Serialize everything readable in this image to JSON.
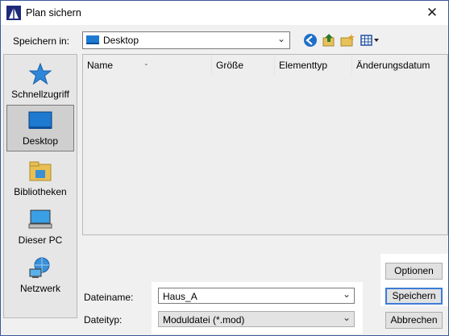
{
  "window": {
    "title": "Plan sichern",
    "close_glyph": "✕",
    "accent": "#3a5a9c"
  },
  "toolbar": {
    "save_in_label": "Speichern in:",
    "location_value": "Desktop",
    "location_icon": "desktop-icon",
    "icons": [
      "back-icon",
      "up-folder-icon",
      "new-folder-icon",
      "view-menu-icon"
    ]
  },
  "places": [
    {
      "label": "Schnellzugriff",
      "icon": "star-icon"
    },
    {
      "label": "Desktop",
      "icon": "desktop-icon",
      "selected": true
    },
    {
      "label": "Bibliotheken",
      "icon": "library-folder-icon"
    },
    {
      "label": "Dieser PC",
      "icon": "computer-icon"
    },
    {
      "label": "Netzwerk",
      "icon": "network-icon"
    }
  ],
  "file_list": {
    "columns": [
      "Name",
      "Größe",
      "Elementtyp",
      "Änderungsdatum"
    ],
    "sort_glyph": "⌄"
  },
  "form": {
    "filename_label": "Dateiname:",
    "filename_value": "Haus_A",
    "filetype_label": "Dateityp:",
    "filetype_value": "Moduldatei (*.mod)",
    "dropdown_glyph": "⌄"
  },
  "buttons": {
    "options": "Optionen",
    "save": "Speichern",
    "cancel": "Abbrechen"
  }
}
